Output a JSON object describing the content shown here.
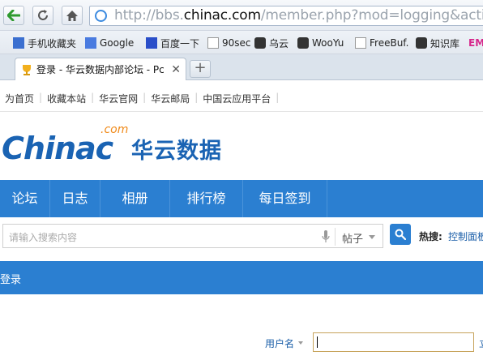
{
  "browser": {
    "url_prefix": "http://bbs.",
    "url_domain": "chinac.com",
    "url_suffix": "/member.php?mod=logging&action=lo",
    "tab_title": "登录 - 华云数据内部论坛 - Pc",
    "bookmarks": [
      {
        "label": "手机收藏夹",
        "icon": "phone-icon"
      },
      {
        "label": "Google",
        "icon": "google-icon"
      },
      {
        "label": "百度一下",
        "icon": "baidu-paw-icon"
      },
      {
        "label": "90sec",
        "icon": "page-icon"
      },
      {
        "label": "乌云",
        "icon": "cloud-icon"
      },
      {
        "label": "WooYu",
        "icon": "cloud-icon"
      },
      {
        "label": "FreeBuf.",
        "icon": "page-icon"
      },
      {
        "label": "知识库",
        "icon": "cloud-icon"
      },
      {
        "label": "EM",
        "icon": "em-icon"
      }
    ]
  },
  "site": {
    "top_links": [
      "为首页",
      "收藏本站",
      "华云官网",
      "华云邮局",
      "中国云应用平台"
    ],
    "logo_text": "Chinac",
    "logo_com": ".com",
    "logo_cn": "华云数据",
    "nav_items": [
      "论坛",
      "日志",
      "相册",
      "排行榜",
      "每日签到"
    ],
    "search": {
      "placeholder": "请输入搜索内容",
      "type_label": "帖子",
      "hot_label": "热搜:",
      "hot_link": "控制面板"
    },
    "login_title": "登录",
    "form": {
      "username_label": "用户名",
      "side_text": "立"
    }
  },
  "colors": {
    "primary_blue": "#2b7fd1",
    "logo_blue": "#1a63b3",
    "logo_orange": "#f08a1a",
    "link_blue": "#1a5ea8"
  }
}
